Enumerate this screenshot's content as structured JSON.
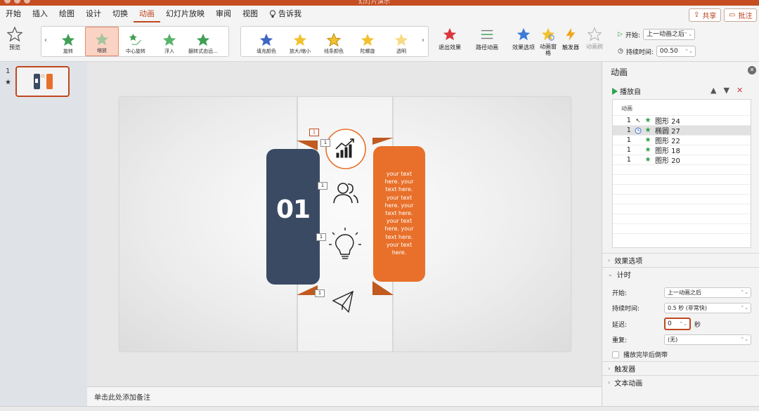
{
  "window": {
    "doc_title": "幻灯片演示"
  },
  "menu": {
    "tabs": [
      "开始",
      "插入",
      "绘图",
      "设计",
      "切换",
      "动画",
      "幻灯片放映",
      "审阅",
      "视图"
    ],
    "active_tab": "动画",
    "tell_me": "告诉我",
    "share": "共享",
    "comment": "批注"
  },
  "ribbon": {
    "preview": "预览",
    "entrance_effects": [
      "旋转",
      "缩放",
      "中心旋转",
      "浮入",
      "翻转式由远..."
    ],
    "selected_effect": "缩放",
    "emphasis_effects": [
      "填充颜色",
      "放大/缩小",
      "线条颜色",
      "陀螺旋",
      "透明"
    ],
    "exit_effects": "退出效果",
    "motion_paths": "路径动画",
    "effect_options": "效果选项",
    "animation_pane": "动画窗格",
    "trigger": "触发器",
    "animate_as": "动画刷",
    "start_label": "开始:",
    "start_value": "上一动画之后",
    "duration_label": "持续时间:",
    "duration_value": "00.50"
  },
  "thumbnails": {
    "slide_number": "1",
    "star": "★"
  },
  "slide": {
    "number_text": "01",
    "body_text": "your text here. your text here. your text here. your text here. your text here. your text here. your text here.",
    "tags": [
      "1",
      "1",
      "1",
      "1",
      "1"
    ],
    "colors": {
      "navy": "#3a4a63",
      "orange": "#e8702a",
      "dark_orange": "#c05a20"
    }
  },
  "notes": {
    "placeholder": "单击此处添加备注"
  },
  "pane": {
    "title": "动画",
    "play_from": "播放自",
    "list_header": "动画",
    "items": [
      {
        "order": "1",
        "name": "图形 24",
        "has_clock": false
      },
      {
        "order": "1",
        "name": "椭圆 27",
        "has_clock": true
      },
      {
        "order": "1",
        "name": "图形 22",
        "has_clock": false
      },
      {
        "order": "1",
        "name": "图形 18",
        "has_clock": false
      },
      {
        "order": "1",
        "name": "图形 20",
        "has_clock": false
      }
    ],
    "effect_options": "效果选项",
    "timing": "计时",
    "start_label": "开始:",
    "start_value": "上一动画之后",
    "duration_label": "持续时间:",
    "duration_value": "0.5 秒 (非常快)",
    "delay_label": "延迟:",
    "delay_value": "0",
    "delay_unit": "秒",
    "repeat_label": "重复:",
    "repeat_value": "(无)",
    "rewind_label": "播放完毕后倒带",
    "triggers": "触发器",
    "text_animation": "文本动画"
  }
}
